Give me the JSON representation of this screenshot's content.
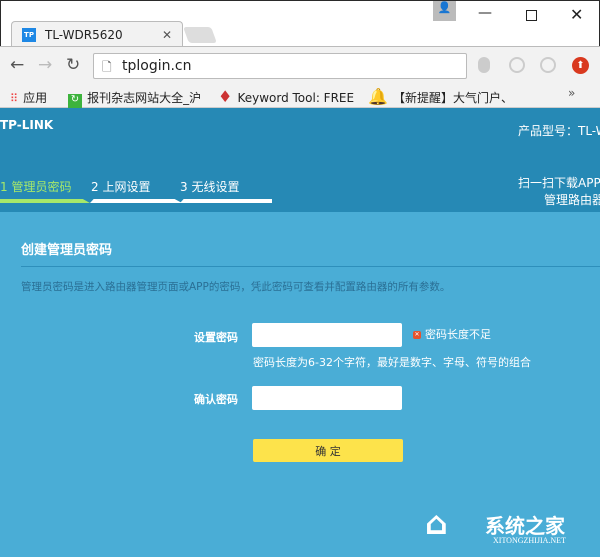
{
  "browser": {
    "tab_title": "TL-WDR5620",
    "favicon": "TP",
    "url": "tplogin.cn",
    "bookmarks": [
      {
        "label": "应用",
        "icon": "apps-icon"
      },
      {
        "label": "报刊杂志网站大全_沪",
        "icon": "refresh-green-icon"
      },
      {
        "label": "Keyword Tool: FREE",
        "icon": "flame-icon"
      },
      {
        "label": "【新提醒】大气门户、",
        "icon": "bell-icon"
      }
    ],
    "more": "»"
  },
  "header": {
    "logo": "TP-LINK",
    "model": "产品型号：TL-W",
    "steps": [
      {
        "label": "1 管理员密码",
        "active": true
      },
      {
        "label": "2 上网设置",
        "active": false
      },
      {
        "label": "3 无线设置",
        "active": false
      }
    ],
    "app_line1": "扫一扫下载APP",
    "app_line2": "管理路由器"
  },
  "main": {
    "title": "创建管理员密码",
    "description": "管理员密码是进入路由器管理页面或APP的密码，凭此密码可查看并配置路由器的所有参数。",
    "password_label": "设置密码",
    "password_value": "",
    "error": "密码长度不足",
    "hint": "密码长度为6-32个字符，最好是数字、字母、符号的组合",
    "confirm_label": "确认密码",
    "confirm_value": "",
    "submit": "确 定"
  },
  "watermark": {
    "text": "系统之家",
    "sub": "XITONGZHIJIA.NET"
  },
  "colors": {
    "header": "#2689b5",
    "main": "#4aadd6",
    "button": "#fde34b",
    "active_step": "#a6e86a"
  }
}
